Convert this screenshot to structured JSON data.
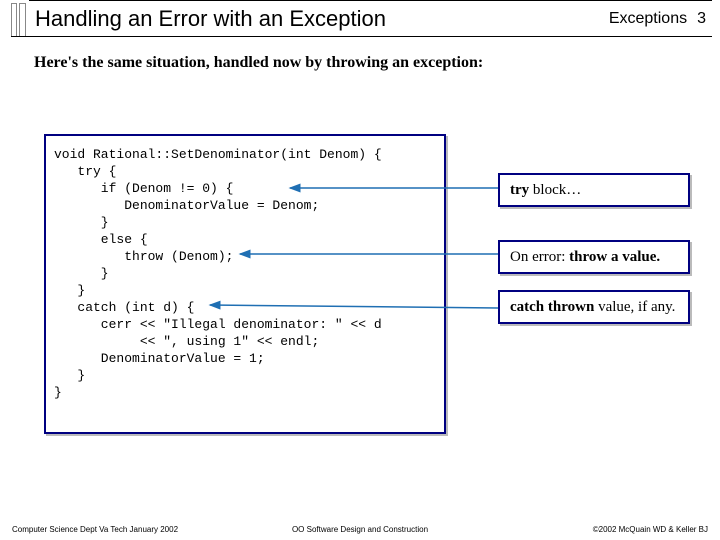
{
  "header": {
    "title": "Handling an Error with an Exception",
    "topic": "Exceptions",
    "page": "3"
  },
  "intro": "Here's the same situation, handled now by throwing an exception:",
  "code": "void Rational::SetDenominator(int Denom) {\n   try {\n      if (Denom != 0) {\n         DenominatorValue = Denom;\n      }\n      else {\n         throw (Denom);\n      }\n   }\n   catch (int d) {\n      cerr << \"Illegal denominator: \" << d\n           << \", using 1\" << endl;\n      DenominatorValue = 1;\n   }\n}",
  "annotations": {
    "a1_prefix": "try",
    "a1_rest": " block…",
    "a2_prefix": "On error: ",
    "a2_bold": "throw a value.",
    "a3_bold": "catch thrown",
    "a3_rest": " value, if any."
  },
  "footer": {
    "left": "Computer Science Dept Va Tech January 2002",
    "center": "OO Software Design and Construction",
    "right": "©2002 McQuain WD & Keller BJ"
  }
}
